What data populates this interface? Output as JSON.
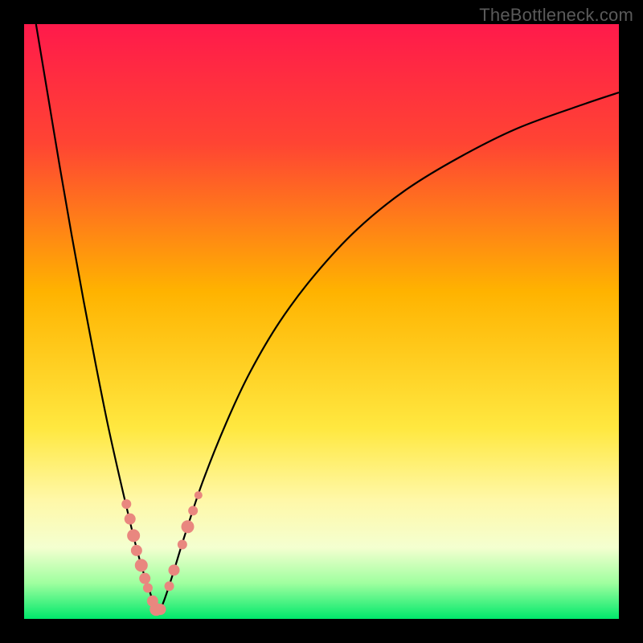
{
  "watermark": "TheBottleneck.com",
  "chart_data": {
    "type": "line",
    "title": "",
    "xlabel": "",
    "ylabel": "",
    "xlim": [
      0,
      100
    ],
    "ylim": [
      0,
      100
    ],
    "background_gradient": {
      "stops": [
        {
          "offset": 0.0,
          "color": "#ff1a4b"
        },
        {
          "offset": 0.2,
          "color": "#ff4433"
        },
        {
          "offset": 0.45,
          "color": "#ffb300"
        },
        {
          "offset": 0.68,
          "color": "#ffe840"
        },
        {
          "offset": 0.8,
          "color": "#fff8a8"
        },
        {
          "offset": 0.88,
          "color": "#f4ffd0"
        },
        {
          "offset": 0.94,
          "color": "#9fff9f"
        },
        {
          "offset": 1.0,
          "color": "#00e86b"
        }
      ]
    },
    "series": [
      {
        "name": "bottleneck-curve",
        "color": "#000000",
        "x": [
          2,
          4,
          6,
          8,
          10,
          12,
          14,
          16,
          18,
          19,
          20,
          21,
          21.8,
          22.5,
          23.5,
          25,
          27,
          30,
          34,
          38,
          43,
          49,
          56,
          64,
          73,
          83,
          94,
          100
        ],
        "y": [
          100,
          88,
          76,
          64.5,
          53.5,
          43,
          33,
          24,
          15.5,
          11.5,
          8,
          5,
          2.5,
          1,
          3,
          7.5,
          14,
          23,
          33,
          41.5,
          50,
          58,
          65.5,
          72,
          77.5,
          82.5,
          86.5,
          88.5
        ]
      }
    ],
    "markers": {
      "name": "highlight-dots",
      "color": "#e9877f",
      "radius_range": [
        4,
        10
      ],
      "points": [
        {
          "x": 17.2,
          "y": 19.3,
          "r": 6
        },
        {
          "x": 17.8,
          "y": 16.8,
          "r": 7
        },
        {
          "x": 18.4,
          "y": 14.0,
          "r": 8
        },
        {
          "x": 18.9,
          "y": 11.5,
          "r": 7
        },
        {
          "x": 19.7,
          "y": 9.0,
          "r": 8
        },
        {
          "x": 20.3,
          "y": 6.8,
          "r": 7
        },
        {
          "x": 20.8,
          "y": 5.2,
          "r": 6
        },
        {
          "x": 21.6,
          "y": 3.0,
          "r": 7
        },
        {
          "x": 22.2,
          "y": 1.6,
          "r": 8
        },
        {
          "x": 22.9,
          "y": 1.6,
          "r": 7
        },
        {
          "x": 24.4,
          "y": 5.5,
          "r": 6
        },
        {
          "x": 25.2,
          "y": 8.2,
          "r": 7
        },
        {
          "x": 26.6,
          "y": 12.5,
          "r": 6
        },
        {
          "x": 27.5,
          "y": 15.5,
          "r": 8
        },
        {
          "x": 28.4,
          "y": 18.2,
          "r": 6
        },
        {
          "x": 29.3,
          "y": 20.8,
          "r": 5
        }
      ]
    }
  }
}
